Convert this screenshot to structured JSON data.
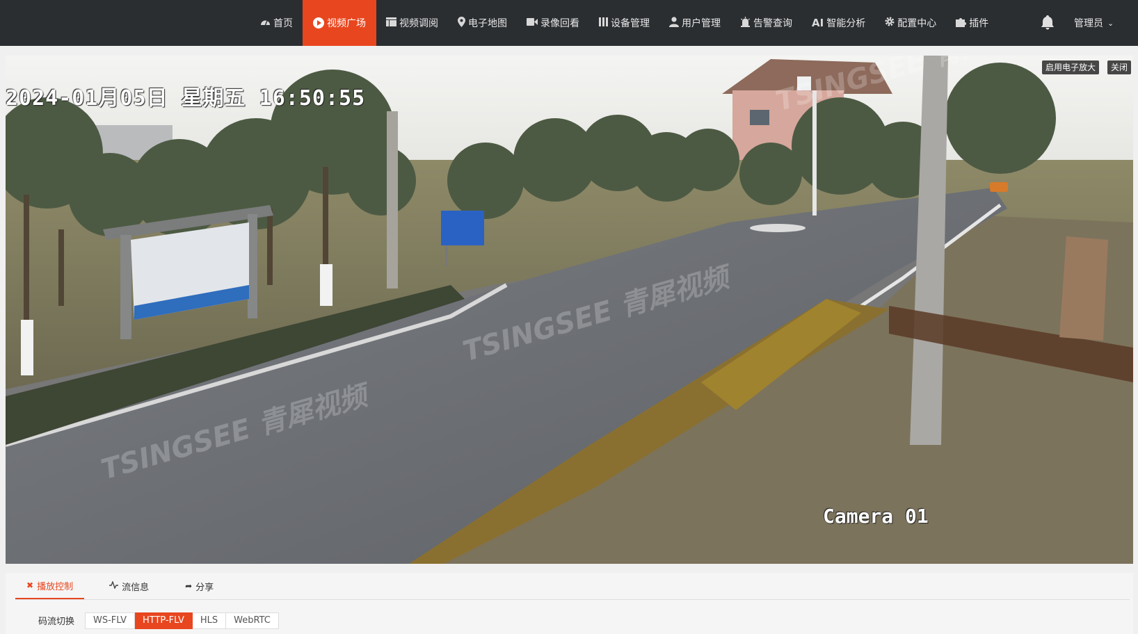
{
  "nav": {
    "items": [
      {
        "label": "首页",
        "icon": "dashboard-icon"
      },
      {
        "label": "视频广场",
        "icon": "play-circle-icon",
        "active": true
      },
      {
        "label": "视频调阅",
        "icon": "grid-icon"
      },
      {
        "label": "电子地图",
        "icon": "map-pin-icon"
      },
      {
        "label": "录像回看",
        "icon": "video-camera-icon"
      },
      {
        "label": "设备管理",
        "icon": "device-icon"
      },
      {
        "label": "用户管理",
        "icon": "user-icon"
      },
      {
        "label": "告警查询",
        "icon": "alarm-icon"
      },
      {
        "label": "智能分析",
        "icon": "ai-icon",
        "prefix": "AI"
      },
      {
        "label": "配置中心",
        "icon": "gear-icon"
      },
      {
        "label": "插件",
        "icon": "puzzle-icon"
      }
    ],
    "user": "管理员",
    "accent": "#e8461f",
    "background": "#2b2e31"
  },
  "video": {
    "osd_timestamp": "2024-01月05日 星期五 16:50:55",
    "osd_camera": "Camera 01",
    "zoom_button": "启用电子放大",
    "close_button": "关闭",
    "watermark": "TSINGSEE 青犀视频"
  },
  "panel": {
    "tabs": [
      {
        "label": "播放控制",
        "icon": "tools-icon",
        "active": true
      },
      {
        "label": "流信息",
        "icon": "pulse-icon"
      },
      {
        "label": "分享",
        "icon": "share-icon"
      }
    ],
    "stream_label": "码流切换",
    "stream_options": [
      {
        "label": "WS-FLV"
      },
      {
        "label": "HTTP-FLV",
        "active": true
      },
      {
        "label": "HLS"
      },
      {
        "label": "WebRTC"
      }
    ]
  }
}
